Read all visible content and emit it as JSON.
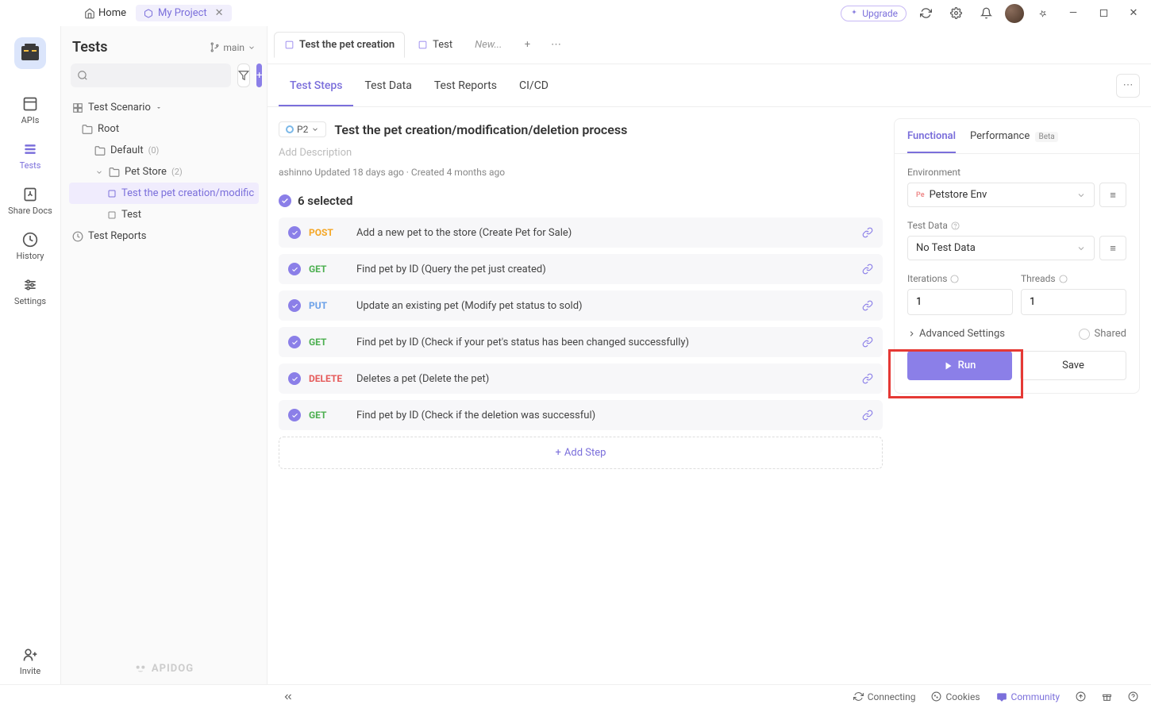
{
  "titlebar": {
    "home": "Home",
    "project": "My Project",
    "upgrade": "Upgrade"
  },
  "rail": {
    "apis": "APIs",
    "tests": "Tests",
    "share": "Share Docs",
    "history": "History",
    "settings": "Settings",
    "invite": "Invite"
  },
  "sidebar": {
    "title": "Tests",
    "branch": "main",
    "scenario": "Test Scenario",
    "root": "Root",
    "default": "Default",
    "default_count": "(0)",
    "petstore": "Pet Store",
    "petstore_count": "(2)",
    "test1": "Test the pet creation/modific",
    "test2": "Test",
    "reports": "Test Reports",
    "brand": "APIDOG"
  },
  "tabs": {
    "t1": "Test the pet creation",
    "t2": "Test",
    "t3": "New...",
    "subtabs": [
      "Test Steps",
      "Test Data",
      "Test Reports",
      "CI/CD"
    ]
  },
  "main": {
    "priority": "P2",
    "title": "Test the pet creation/modification/deletion process",
    "desc_placeholder": "Add Description",
    "meta": "ashinno Updated 18 days ago · Created 4 months ago",
    "selected": "6 selected",
    "steps": [
      {
        "method": "POST",
        "cls": "m-post",
        "name": "Add a new pet to the store (Create Pet for Sale)"
      },
      {
        "method": "GET",
        "cls": "m-get",
        "name": "Find pet by ID (Query the pet just created)"
      },
      {
        "method": "PUT",
        "cls": "m-put",
        "name": "Update an existing pet (Modify pet status to sold)"
      },
      {
        "method": "GET",
        "cls": "m-get",
        "name": "Find pet by ID (Check if your pet's status has been changed successfully)"
      },
      {
        "method": "DELETE",
        "cls": "m-delete",
        "name": "Deletes a pet (Delete the pet)"
      },
      {
        "method": "GET",
        "cls": "m-get",
        "name": "Find pet by ID (Check if the deletion was successful)"
      }
    ],
    "add_step": "Add Step"
  },
  "right": {
    "functional": "Functional",
    "performance": "Performance",
    "beta": "Beta",
    "env_label": "Environment",
    "env_value": "Petstore Env",
    "data_label": "Test Data",
    "data_value": "No Test Data",
    "iter_label": "Iterations",
    "iter_value": "1",
    "threads_label": "Threads",
    "threads_value": "1",
    "adv": "Advanced Settings",
    "shared": "Shared",
    "run": "Run",
    "save": "Save"
  },
  "status": {
    "connecting": "Connecting",
    "cookies": "Cookies",
    "community": "Community"
  }
}
